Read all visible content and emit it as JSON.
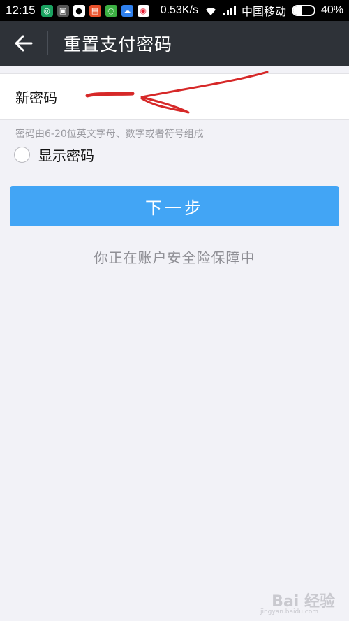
{
  "status_bar": {
    "time": "12:15",
    "network_speed": "0.53K/s",
    "carrier": "中国移动",
    "battery": "40%",
    "battery_level": 0.4,
    "apps": [
      {
        "icon": "app-icon",
        "color": "#1aa260"
      },
      {
        "icon": "app-icon",
        "color": "#555555"
      },
      {
        "icon": "qq-icon",
        "color": "#111111"
      },
      {
        "icon": "app-icon",
        "color": "#e8502a"
      },
      {
        "icon": "app-icon",
        "color": "#3cb043"
      },
      {
        "icon": "cloud-icon",
        "color": "#2f80ed"
      },
      {
        "icon": "weibo-icon",
        "color": "#e6162d"
      }
    ]
  },
  "nav": {
    "title": "重置支付密码"
  },
  "form": {
    "new_password_label": "新密码",
    "password_value": "",
    "hint": "密码由6-20位英文字母、数字或者符号组成",
    "show_password_label": "显示密码"
  },
  "actions": {
    "next_label": "下一步"
  },
  "footer": {
    "safety_text": "你正在账户安全险保障中"
  },
  "watermark": {
    "text": "Bai 经验",
    "sub": "jingyan.baidu.com"
  },
  "colors": {
    "nav_bg": "#2e3238",
    "button": "#42a5f5",
    "page_bg": "#f2f2f7",
    "annotation": "#d62828"
  }
}
